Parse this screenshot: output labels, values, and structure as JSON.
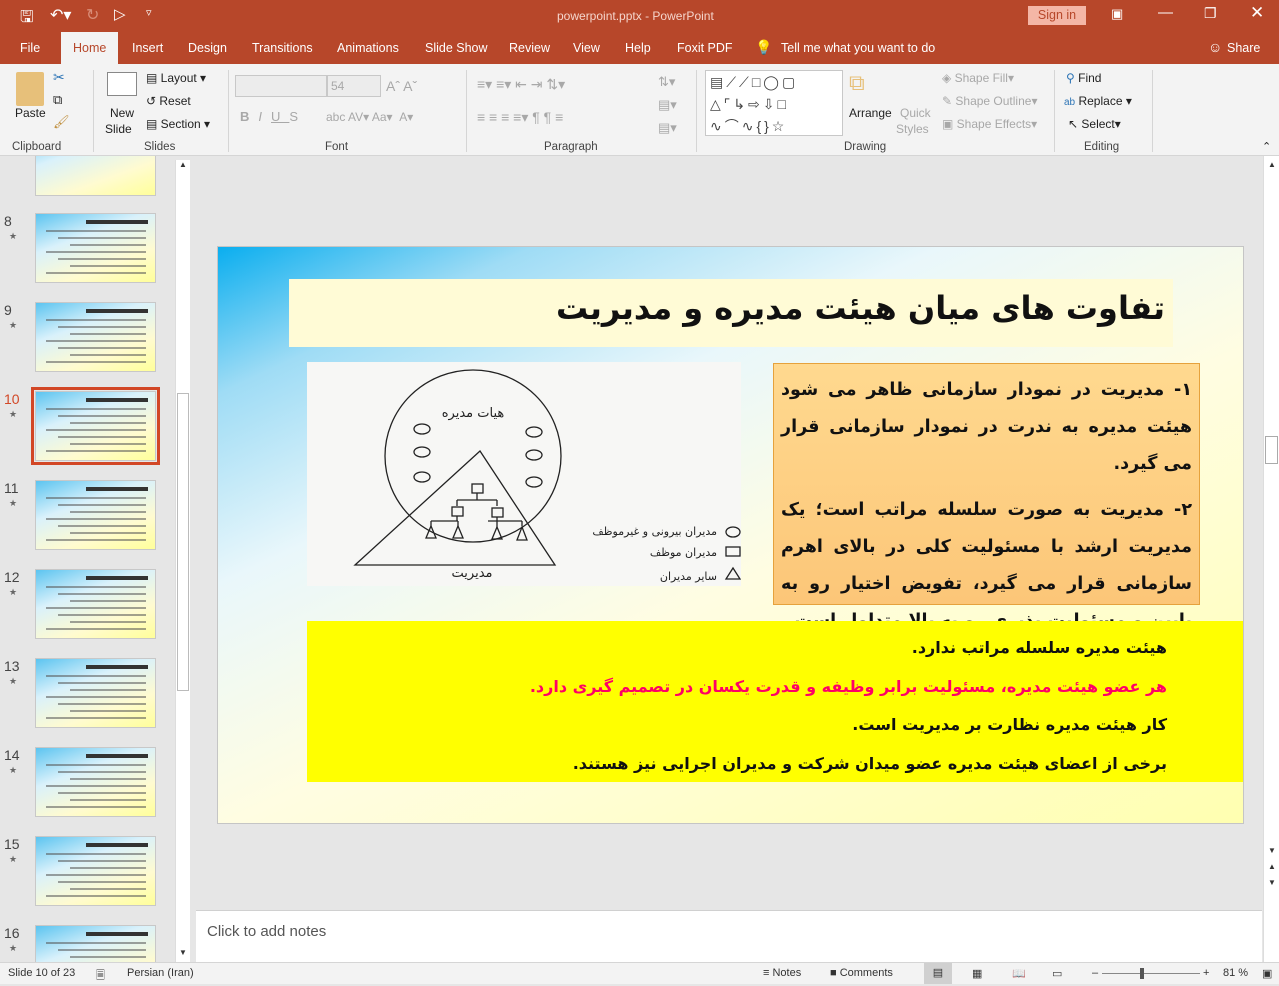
{
  "titlebar": {
    "filename": "powerpoint.pptx",
    "separator": "-",
    "app": "PowerPoint",
    "sign_in": "Sign in"
  },
  "tabs": [
    {
      "label": "File"
    },
    {
      "label": "Home"
    },
    {
      "label": "Insert"
    },
    {
      "label": "Design"
    },
    {
      "label": "Transitions"
    },
    {
      "label": "Animations"
    },
    {
      "label": "Slide Show"
    },
    {
      "label": "Review"
    },
    {
      "label": "View"
    },
    {
      "label": "Help"
    },
    {
      "label": "Foxit PDF"
    }
  ],
  "tell_me": "Tell me what you want to do",
  "share": "Share",
  "ribbon": {
    "clipboard": {
      "label": "Clipboard",
      "paste": "Paste"
    },
    "slides": {
      "label": "Slides",
      "new_slide_1": "New",
      "new_slide_2": "Slide",
      "layout": "Layout",
      "reset": "Reset",
      "section": "Section"
    },
    "font": {
      "label": "Font",
      "font_name": "",
      "font_size": "54"
    },
    "paragraph": {
      "label": "Paragraph"
    },
    "drawing": {
      "label": "Drawing",
      "arrange": "Arrange",
      "quick_styles_1": "Quick",
      "quick_styles_2": "Styles",
      "shape_fill": "Shape Fill",
      "shape_outline": "Shape Outline",
      "shape_effects": "Shape Effects"
    },
    "editing": {
      "label": "Editing",
      "find": "Find",
      "replace": "Replace",
      "select": "Select"
    }
  },
  "thumbnails": [
    {
      "num": "8"
    },
    {
      "num": "9"
    },
    {
      "num": "10",
      "selected": true
    },
    {
      "num": "11"
    },
    {
      "num": "12"
    },
    {
      "num": "13"
    },
    {
      "num": "14"
    },
    {
      "num": "15"
    },
    {
      "num": "16"
    }
  ],
  "slide": {
    "title": "تفاوت های میان هیئت مدیره و مدیریت",
    "diagram": {
      "board_label": "هیات مدیره",
      "management_label": "مدیریت",
      "legend": [
        "مدیران بیرونی و غیرموظف",
        "مدیران موظف",
        "سایر مدیران"
      ]
    },
    "orange_paragraphs": [
      "۱- مدیریت در نمودار سازمانی ظاهر می شود هیئت مدیره به ندرت در نمودار سازمانی قرار می گیرد.",
      "۲- مدیریت به صورت سلسله مراتب است؛ یک مدیریت ارشد با مسئولیت کلی در بالای اهرم سازمانی قرار می گیرد، تفویض اختیار رو به پایین و مسئولیت پذیری رو به بالا متداول است."
    ],
    "yellow_lines": [
      {
        "text": "هیئت مدیره سلسله مراتب ندارد.",
        "color": "#111111"
      },
      {
        "text": "هر عضو هیئت مدیره، مسئولیت برابر وظیفه و قدرت یکسان در تصمیم گیری دارد.",
        "color": "#ff0066"
      },
      {
        "text": "کار هیئت مدیره نظارت بر مدیریت است.",
        "color": "#111111"
      },
      {
        "text": "برخی از اعضای هیئت مدیره عضو میدان شرکت و مدیران اجرایی نیز هستند.",
        "color": "#111111"
      }
    ]
  },
  "notes_placeholder": "Click to add notes",
  "status": {
    "slide_info": "Slide 10 of 23",
    "language": "Persian (Iran)",
    "notes": "Notes",
    "comments": "Comments",
    "zoom": "81 %",
    "zoom_level_percent": 81
  },
  "colors": {
    "accent": "#b7472a",
    "selected_thumb": "#d24726"
  }
}
